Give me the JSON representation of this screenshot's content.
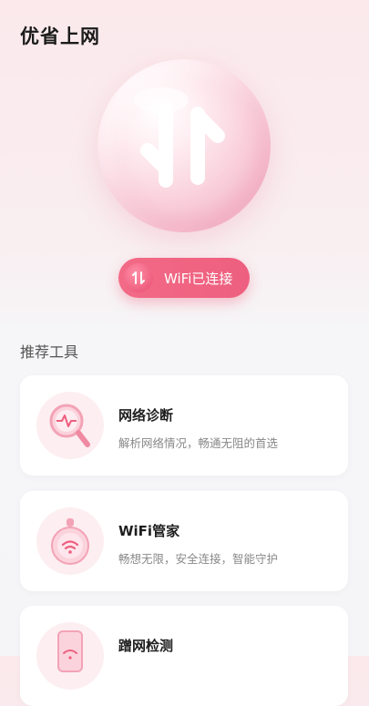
{
  "header": {
    "title": "优省上网"
  },
  "hero": {
    "bubble_icon": "transfer-arrows-icon"
  },
  "status": {
    "label": "WiFi已连接",
    "icon": "transfer-arrows-icon"
  },
  "section": {
    "title": "推荐工具"
  },
  "tools": [
    {
      "name": "网络诊断",
      "desc": "解析网络情况，畅通无阻的首选",
      "icon": "magnifier-pulse-icon"
    },
    {
      "name": "WiFi管家",
      "desc": "畅想无限，安全连接，智能守护",
      "icon": "wifi-router-icon"
    },
    {
      "name": "蹭网检测",
      "desc": "",
      "icon": "phone-wifi-icon"
    }
  ],
  "colors": {
    "accent": "#ee5f7f",
    "accent_light": "#fdeef1",
    "background": "#f5f5f7"
  }
}
